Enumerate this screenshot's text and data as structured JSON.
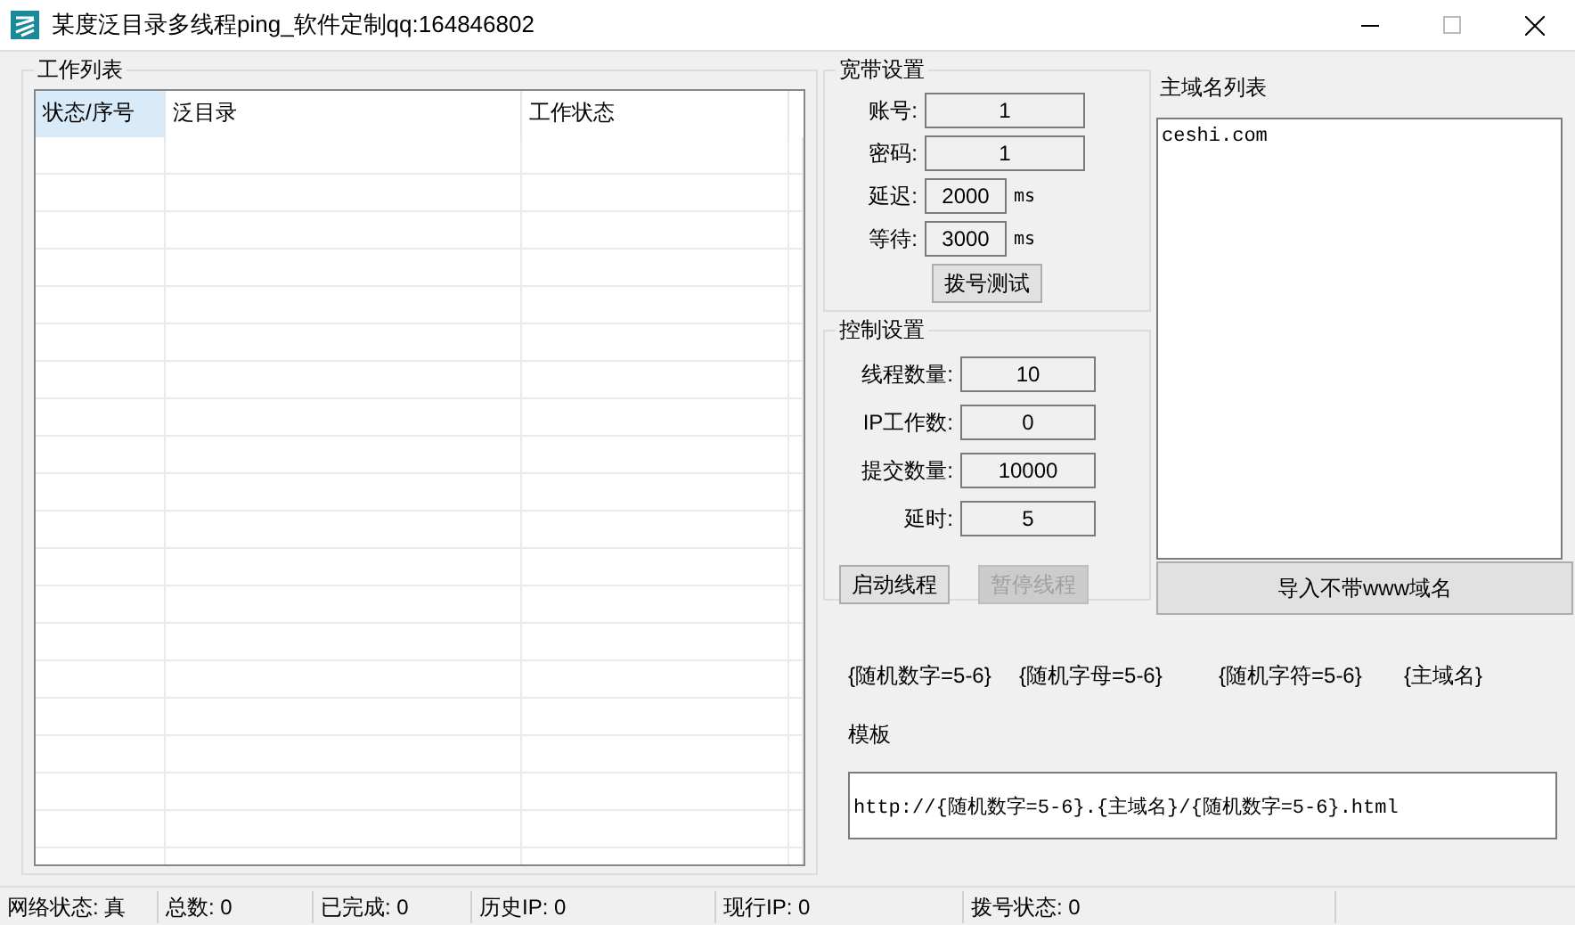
{
  "window": {
    "title": "某度泛目录多线程ping_软件定制qq:164846802"
  },
  "work_list": {
    "title": "工作列表",
    "columns": [
      {
        "label": "状态/序号",
        "selected": true
      },
      {
        "label": "泛目录",
        "selected": false
      },
      {
        "label": "工作状态",
        "selected": false
      }
    ]
  },
  "broadband": {
    "title": "宽带设置",
    "fields": [
      {
        "label": "账号:",
        "value": "1"
      },
      {
        "label": "密码:",
        "value": "1"
      },
      {
        "label": "延迟:",
        "value": "2000",
        "unit": "ms"
      },
      {
        "label": "等待:",
        "value": "3000",
        "unit": "ms"
      }
    ],
    "button": "拨号测试"
  },
  "control": {
    "title": "控制设置",
    "fields": [
      {
        "label": "线程数量:",
        "value": "10"
      },
      {
        "label": "IP工作数:",
        "value": "0"
      },
      {
        "label": "提交数量:",
        "value": "10000"
      },
      {
        "label": "延时:",
        "value": "5"
      }
    ],
    "buttons": [
      {
        "label": "启动线程",
        "disabled": false
      },
      {
        "label": "暂停线程",
        "disabled": true
      }
    ]
  },
  "domain_list": {
    "title": "主域名列表",
    "content": "ceshi.com",
    "button": "导入不带www域名"
  },
  "tokens": [
    "{随机数字=5-6}",
    "{随机字母=5-6}",
    "{随机字符=5-6}",
    "{主域名}"
  ],
  "template": {
    "label": "模板",
    "value": "http://{随机数字=5-6}.{主域名}/{随机数字=5-6}.html"
  },
  "status_bar": [
    "网络状态: 真",
    "总数: 0",
    "已完成: 0",
    "历史IP: 0",
    "现行IP: 0",
    "拨号状态: 0"
  ]
}
